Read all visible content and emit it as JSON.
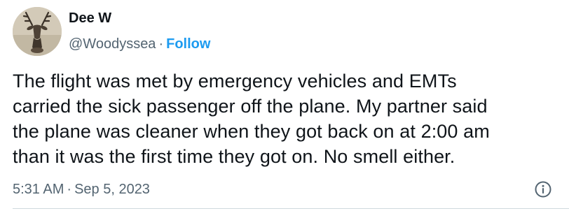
{
  "author": {
    "display_name": "Dee W",
    "handle": "@Woodyssea",
    "separator": "·",
    "follow_label": "Follow",
    "avatar_icon": "deer-head-mount-avatar"
  },
  "tweet": {
    "lines": [
      "The flight was met by emergency vehicles and EMTs",
      "carried the sick passenger off the plane. My partner said",
      "the plane was cleaner when they got back on at 2:00 am",
      "than it was the first time they got on. No smell either."
    ]
  },
  "meta": {
    "time": "5:31 AM",
    "separator": "·",
    "date": "Sep 5, 2023",
    "info_icon": "info-icon"
  },
  "colors": {
    "text": "#0f1419",
    "secondary": "#536471",
    "link": "#1d9bf0",
    "divider": "#cfd9de"
  }
}
